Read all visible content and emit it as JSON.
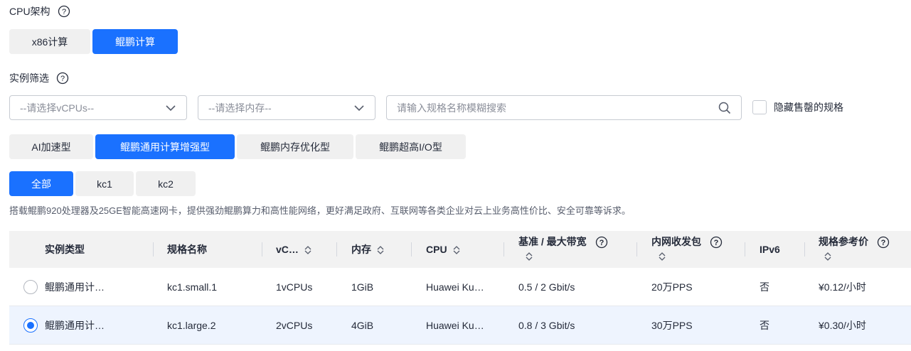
{
  "cpu_arch": {
    "label": "CPU架构",
    "options": [
      "x86计算",
      "鲲鹏计算"
    ],
    "selected": "鲲鹏计算"
  },
  "filter": {
    "label": "实例筛选",
    "vcpu_placeholder": "--请选择vCPUs--",
    "memory_placeholder": "--请选择内存--",
    "search_placeholder": "请输入规格名称模糊搜索",
    "hide_soldout_label": "隐藏售罄的规格"
  },
  "type_tabs": {
    "items": [
      "AI加速型",
      "鲲鹏通用计算增强型",
      "鲲鹏内存优化型",
      "鲲鹏超高I/O型"
    ],
    "selected": "鲲鹏通用计算增强型"
  },
  "sub_tabs": {
    "items": [
      "全部",
      "kc1",
      "kc2"
    ],
    "selected": "全部"
  },
  "description": "搭载鲲鹏920处理器及25GE智能高速网卡，提供强劲鲲鹏算力和高性能网络，更好满足政府、互联网等各类企业对云上业务高性价比、安全可靠等诉求。",
  "table": {
    "headers": {
      "type": "实例类型",
      "name": "规格名称",
      "vcpu": "vC…",
      "memory": "内存",
      "cpu": "CPU",
      "bandwidth": "基准 / 最大带宽",
      "pps": "内网收发包",
      "ipv6": "IPv6",
      "price": "规格参考价"
    },
    "rows": [
      {
        "selected": false,
        "type": "鲲鹏通用计…",
        "name": "kc1.small.1",
        "vcpu": "1vCPUs",
        "memory": "1GiB",
        "cpu": "Huawei Ku…",
        "bandwidth": "0.5 / 2 Gbit/s",
        "pps": "20万PPS",
        "ipv6": "否",
        "price": "¥0.12/小时"
      },
      {
        "selected": true,
        "type": "鲲鹏通用计…",
        "name": "kc1.large.2",
        "vcpu": "2vCPUs",
        "memory": "4GiB",
        "cpu": "Huawei Ku…",
        "bandwidth": "0.8 / 3 Gbit/s",
        "pps": "30万PPS",
        "ipv6": "否",
        "price": "¥0.30/小时"
      }
    ]
  },
  "colors": {
    "accent": "#1a71ff",
    "tab_bg": "#f0f0f0",
    "header_bg": "#f2f2f2",
    "selected_row_bg": "#eef4fe"
  }
}
